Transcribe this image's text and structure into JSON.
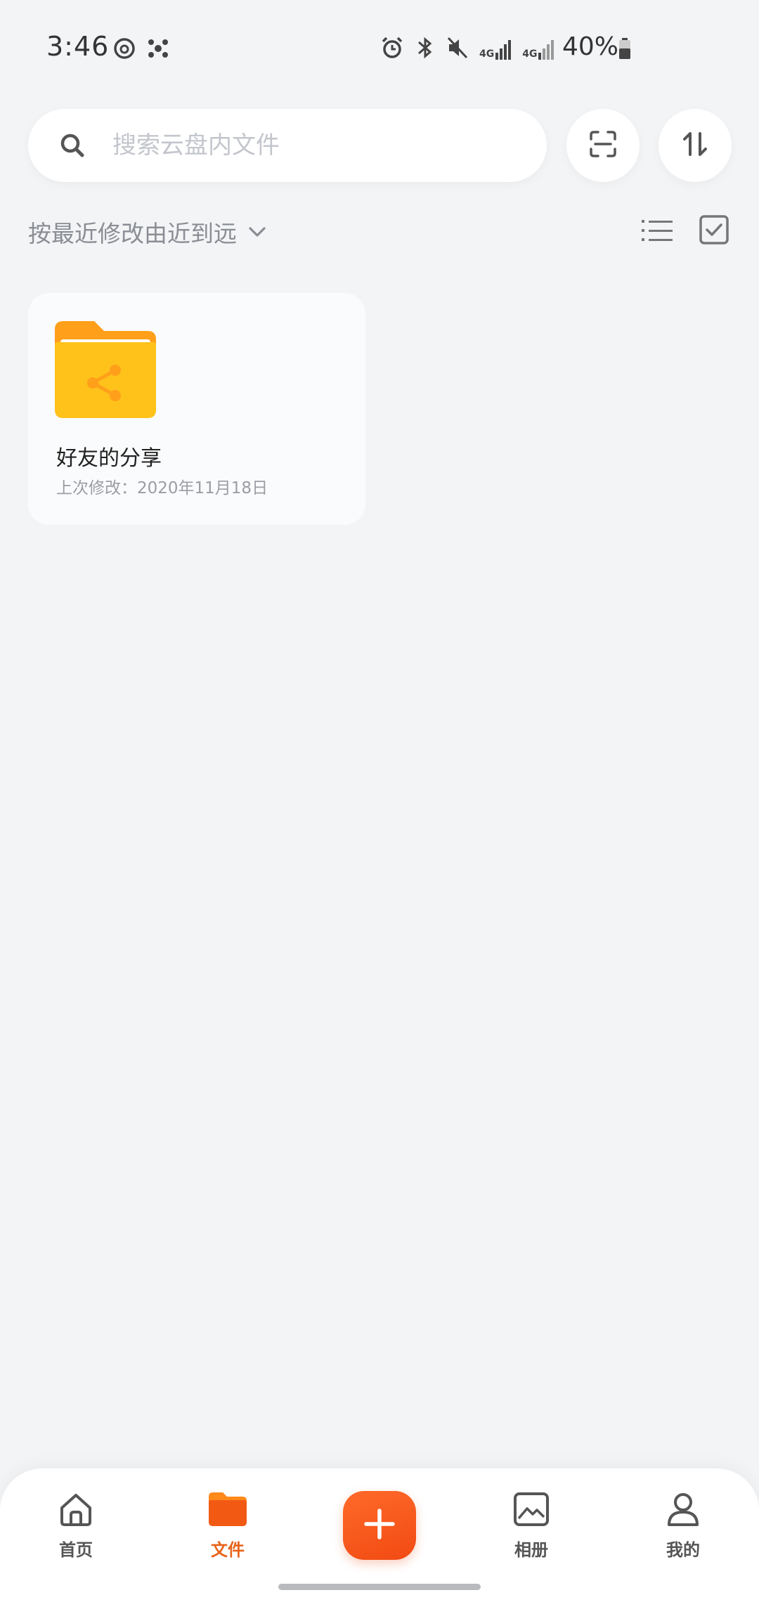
{
  "status_bar": {
    "time": "3:46",
    "network_1": "4G",
    "network_2": "4G",
    "battery": "40%"
  },
  "search": {
    "placeholder": "搜索云盘内文件"
  },
  "sort": {
    "label": "按最近修改由近到远"
  },
  "files": [
    {
      "name": "好友的分享",
      "meta": "上次修改：2020年11月18日",
      "icon": "shared-folder-icon"
    }
  ],
  "nav": {
    "home": "首页",
    "files": "文件",
    "album": "相册",
    "me": "我的",
    "active": "files"
  },
  "colors": {
    "accent": "#f14a12",
    "folder": "#ffc21a",
    "folder_tab": "#ff9f1a",
    "active_label": "#e8631a"
  }
}
